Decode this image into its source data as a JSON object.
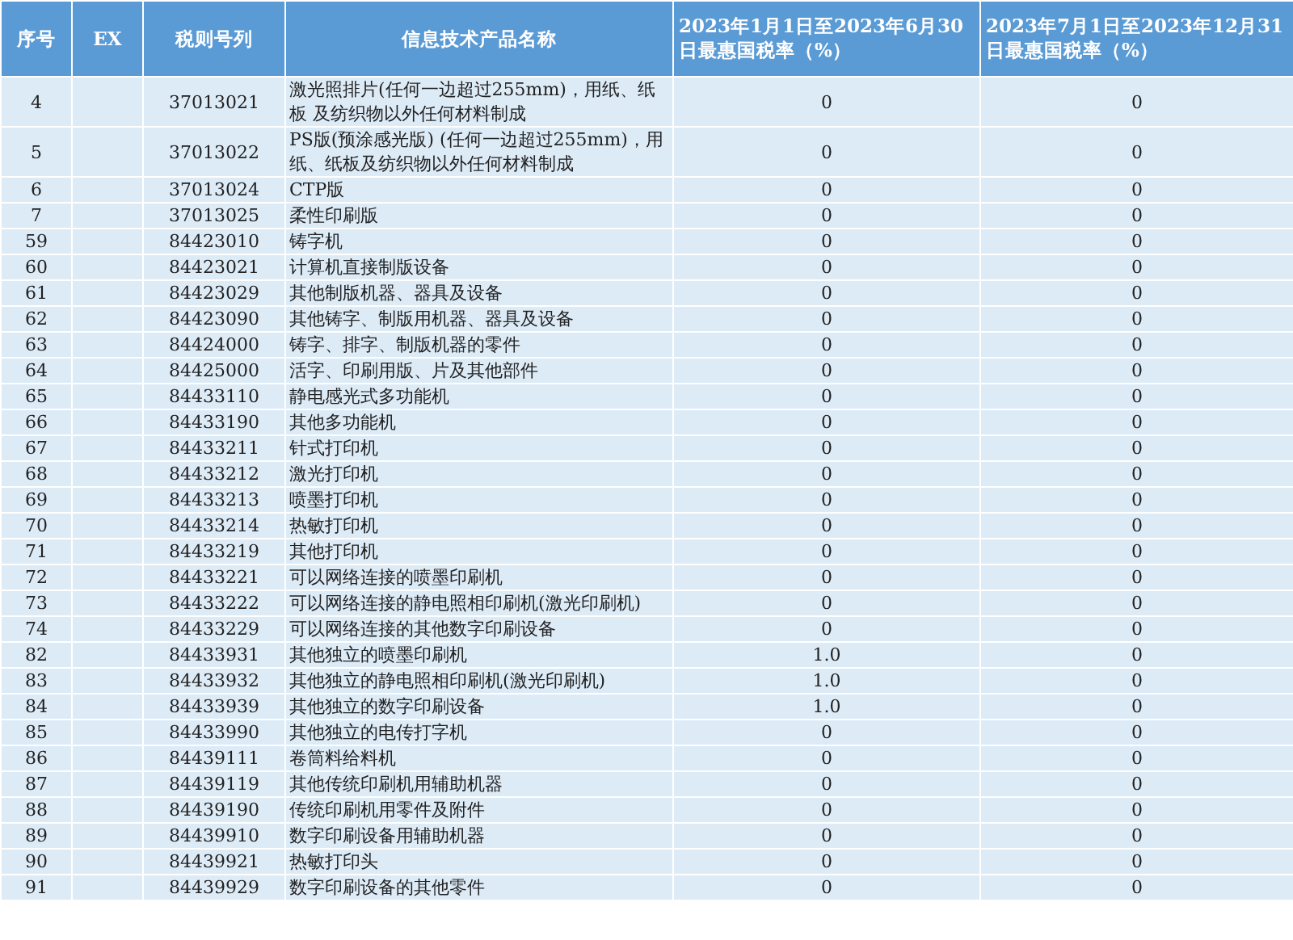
{
  "table": {
    "columns": [
      "序号",
      "EX",
      "税则号列",
      "信息技术产品名称",
      "2023年1月1日至2023年6月30日最惠国税率（%）",
      "2023年7月1日至2023年12月31日最惠国税率（%）"
    ],
    "rows": [
      {
        "no": "4",
        "code": "37013021",
        "name": "激光照排片(任何一边超过255mm)，用纸、纸板 及纺织物以外任何材料制成",
        "rate_h1": "0",
        "rate_h2": "0"
      },
      {
        "no": "5",
        "code": "37013022",
        "name": "PS版(预涂感光版) (任何一边超过255mm)，用纸、纸板及纺织物以外任何材料制成",
        "rate_h1": "0",
        "rate_h2": "0"
      },
      {
        "no": "6",
        "code": "37013024",
        "name": "CTP版",
        "rate_h1": "0",
        "rate_h2": "0"
      },
      {
        "no": "7",
        "code": "37013025",
        "name": "柔性印刷版",
        "rate_h1": "0",
        "rate_h2": "0"
      },
      {
        "no": "59",
        "code": "84423010",
        "name": "铸字机",
        "rate_h1": "0",
        "rate_h2": "0"
      },
      {
        "no": "60",
        "code": "84423021",
        "name": "计算机直接制版设备",
        "rate_h1": "0",
        "rate_h2": "0"
      },
      {
        "no": "61",
        "code": "84423029",
        "name": "其他制版机器、器具及设备",
        "rate_h1": "0",
        "rate_h2": "0"
      },
      {
        "no": "62",
        "code": "84423090",
        "name": "其他铸字、制版用机器、器具及设备",
        "rate_h1": "0",
        "rate_h2": "0"
      },
      {
        "no": "63",
        "code": "84424000",
        "name": "铸字、排字、制版机器的零件",
        "rate_h1": "0",
        "rate_h2": "0"
      },
      {
        "no": "64",
        "code": "84425000",
        "name": "活字、印刷用版、片及其他部件",
        "rate_h1": "0",
        "rate_h2": "0"
      },
      {
        "no": "65",
        "code": "84433110",
        "name": "静电感光式多功能机",
        "rate_h1": "0",
        "rate_h2": "0"
      },
      {
        "no": "66",
        "code": "84433190",
        "name": "其他多功能机",
        "rate_h1": "0",
        "rate_h2": "0"
      },
      {
        "no": "67",
        "code": "84433211",
        "name": "针式打印机",
        "rate_h1": "0",
        "rate_h2": "0"
      },
      {
        "no": "68",
        "code": "84433212",
        "name": "激光打印机",
        "rate_h1": "0",
        "rate_h2": "0"
      },
      {
        "no": "69",
        "code": "84433213",
        "name": "喷墨打印机",
        "rate_h1": "0",
        "rate_h2": "0"
      },
      {
        "no": "70",
        "code": "84433214",
        "name": "热敏打印机",
        "rate_h1": "0",
        "rate_h2": "0"
      },
      {
        "no": "71",
        "code": "84433219",
        "name": "其他打印机",
        "rate_h1": "0",
        "rate_h2": "0"
      },
      {
        "no": "72",
        "code": "84433221",
        "name": "可以网络连接的喷墨印刷机",
        "rate_h1": "0",
        "rate_h2": "0"
      },
      {
        "no": "73",
        "code": "84433222",
        "name": "可以网络连接的静电照相印刷机(激光印刷机)",
        "rate_h1": "0",
        "rate_h2": "0"
      },
      {
        "no": "74",
        "code": "84433229",
        "name": "可以网络连接的其他数字印刷设备",
        "rate_h1": "0",
        "rate_h2": "0"
      },
      {
        "no": "82",
        "code": "84433931",
        "name": "其他独立的喷墨印刷机",
        "rate_h1": "1.0",
        "rate_h2": "0"
      },
      {
        "no": "83",
        "code": "84433932",
        "name": "其他独立的静电照相印刷机(激光印刷机)",
        "rate_h1": "1.0",
        "rate_h2": "0"
      },
      {
        "no": "84",
        "code": "84433939",
        "name": "其他独立的数字印刷设备",
        "rate_h1": "1.0",
        "rate_h2": "0"
      },
      {
        "no": "85",
        "code": "84433990",
        "name": "其他独立的电传打字机",
        "rate_h1": "0",
        "rate_h2": "0"
      },
      {
        "no": "86",
        "code": "84439111",
        "name": "卷筒料给料机",
        "rate_h1": "0",
        "rate_h2": "0"
      },
      {
        "no": "87",
        "code": "84439119",
        "name": "其他传统印刷机用辅助机器",
        "rate_h1": "0",
        "rate_h2": "0"
      },
      {
        "no": "88",
        "code": "84439190",
        "name": "传统印刷机用零件及附件",
        "rate_h1": "0",
        "rate_h2": "0"
      },
      {
        "no": "89",
        "code": "84439910",
        "name": "数字印刷设备用辅助机器",
        "rate_h1": "0",
        "rate_h2": "0"
      },
      {
        "no": "90",
        "code": "84439921",
        "name": "热敏打印头",
        "rate_h1": "0",
        "rate_h2": "0"
      },
      {
        "no": "91",
        "code": "84439929",
        "name": "数字印刷设备的其他零件",
        "rate_h1": "0",
        "rate_h2": "0"
      }
    ]
  }
}
